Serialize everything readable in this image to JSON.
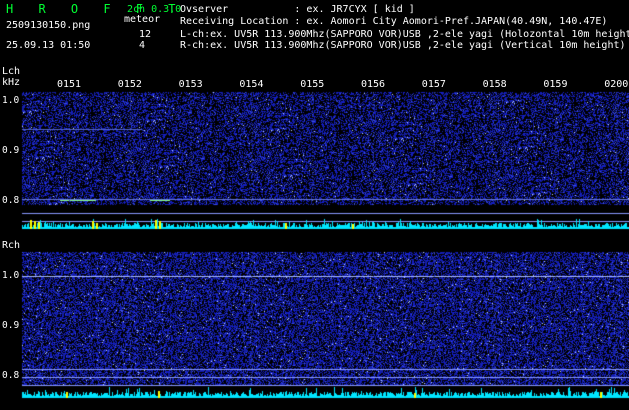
{
  "header": {
    "app_name": "H R O F F T",
    "version": "2ch 0.3.0",
    "filename": "2509130150.png",
    "meteor_label": "meteor",
    "lch_count": "12",
    "rch_count": "4",
    "datetime": "25.09.13 01:50",
    "observer": "Ovserver           : ex. JR7CYX [ kid ]",
    "location": "Receiving Location : ex. Aomori City Aomori-Pref.JAPAN(40.49N, 140.47E)",
    "lch_info": "L-ch:ex. UV5R 113.900Mhz(SAPPORO VOR)USB ,2-ele yagi (Holozontal 10m height)",
    "rch_info": "R-ch:ex. UV5R 113.900Mhz(SAPPORO VOR)USB ,2-ele yagi (Vertical 10m height)"
  },
  "lch": {
    "label": "Lch",
    "unit": "kHz",
    "yticks": [
      "1.0",
      "0.9",
      "0.8"
    ]
  },
  "rch": {
    "label": "Rch",
    "yticks": [
      "1.0",
      "0.9",
      "0.8"
    ]
  },
  "time_ticks": [
    "0151",
    "0152",
    "0153",
    "0154",
    "0155",
    "0156",
    "0157",
    "0158",
    "0159",
    "0200"
  ],
  "colors": {
    "background": "#000000",
    "title_green": "#00ff33",
    "noise_blue": "#2233cc",
    "bar_cyan": "#00ffff",
    "meteor_yellow": "#ffff00"
  }
}
